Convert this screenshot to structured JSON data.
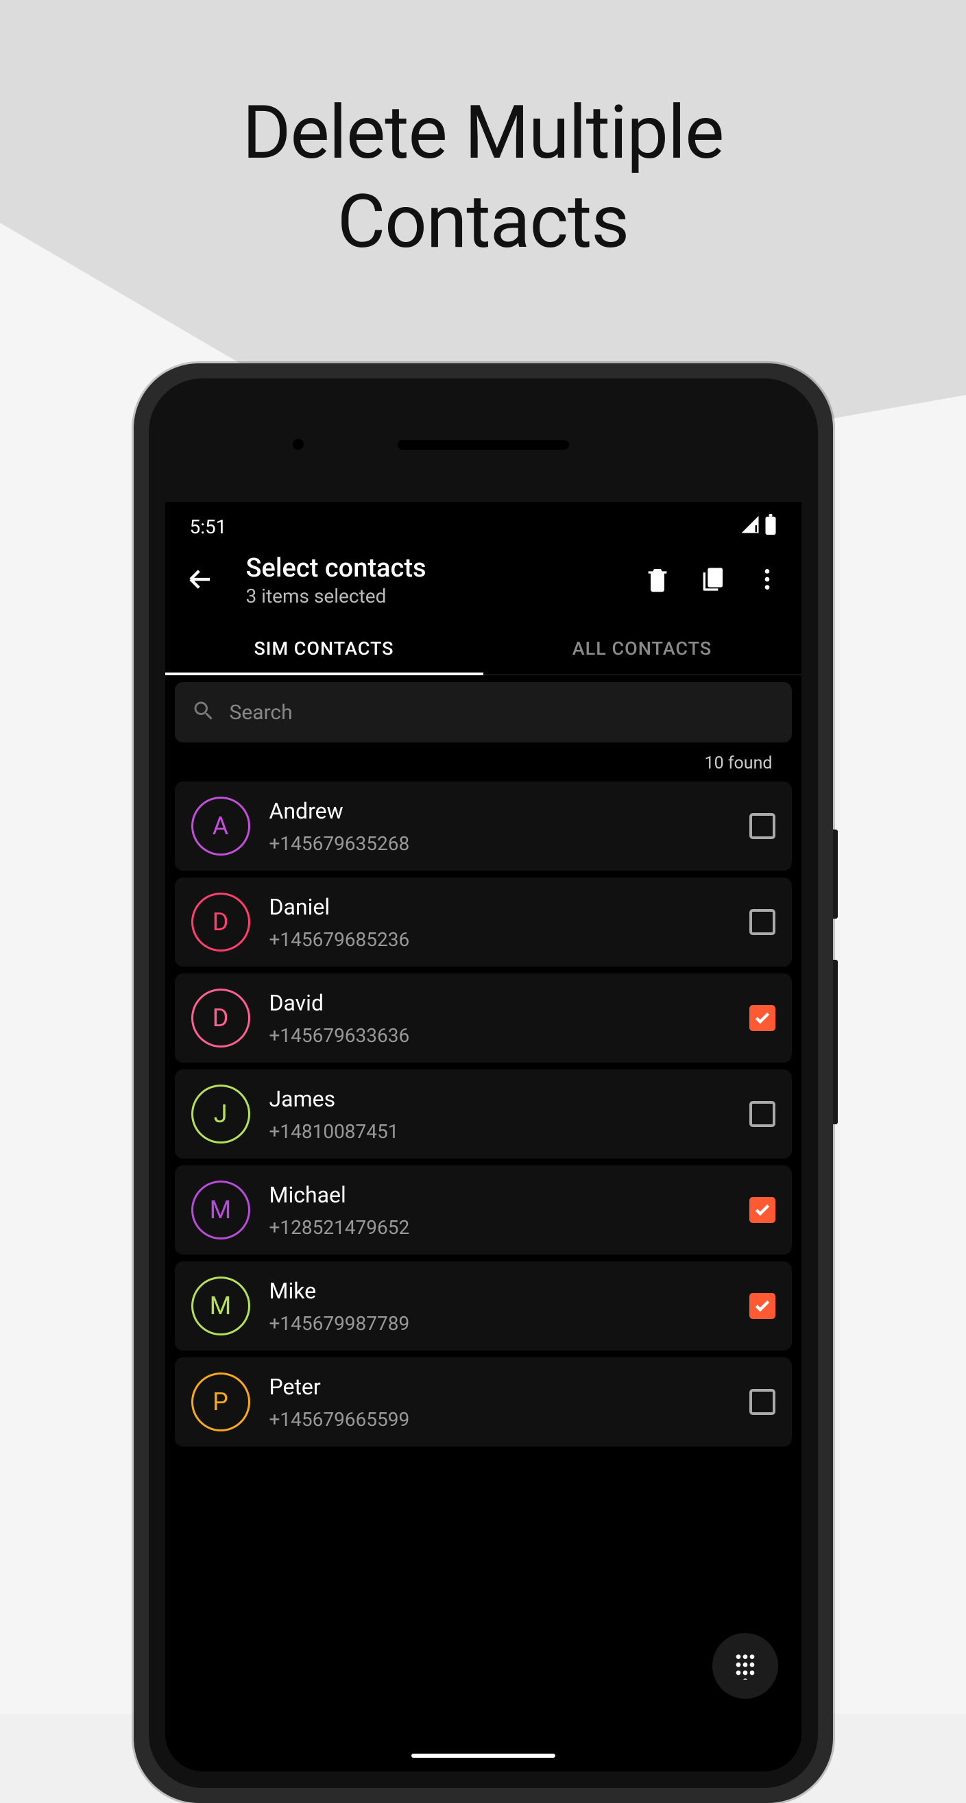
{
  "promo": {
    "title_line1": "Delete Multiple",
    "title_line2": "Contacts"
  },
  "status": {
    "time": "5:51"
  },
  "appbar": {
    "title": "Select contacts",
    "subtitle": "3 items selected"
  },
  "tabs": {
    "sim": "SIM CONTACTS",
    "all": "ALL CONTACTS",
    "active": "sim"
  },
  "search": {
    "placeholder": "Search"
  },
  "found_label": "10 found",
  "contacts": [
    {
      "initial": "A",
      "name": "Andrew",
      "phone": "+145679635268",
      "checked": false,
      "color": "#c24fd8"
    },
    {
      "initial": "D",
      "name": "Daniel",
      "phone": "+145679685236",
      "checked": false,
      "color": "#ff3f6d"
    },
    {
      "initial": "D",
      "name": "David",
      "phone": "+145679633636",
      "checked": true,
      "color": "#ff5f91"
    },
    {
      "initial": "J",
      "name": "James",
      "phone": "+14810087451",
      "checked": false,
      "color": "#b7e05a"
    },
    {
      "initial": "M",
      "name": "Michael",
      "phone": "+128521479652",
      "checked": true,
      "color": "#b64cd8"
    },
    {
      "initial": "M",
      "name": "Mike",
      "phone": "+145679987789",
      "checked": true,
      "color": "#b7e05a"
    },
    {
      "initial": "P",
      "name": "Peter",
      "phone": "+145679665599",
      "checked": false,
      "color": "#f7a81b"
    }
  ]
}
